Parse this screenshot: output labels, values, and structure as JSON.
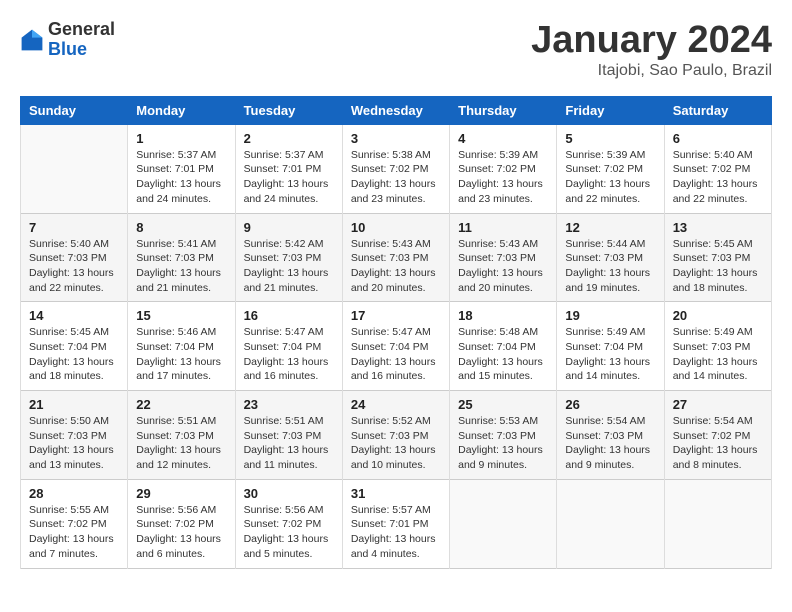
{
  "logo": {
    "general": "General",
    "blue": "Blue"
  },
  "title": "January 2024",
  "location": "Itajobi, Sao Paulo, Brazil",
  "days_header": [
    "Sunday",
    "Monday",
    "Tuesday",
    "Wednesday",
    "Thursday",
    "Friday",
    "Saturday"
  ],
  "weeks": [
    [
      {
        "day": "",
        "info": ""
      },
      {
        "day": "1",
        "info": "Sunrise: 5:37 AM\nSunset: 7:01 PM\nDaylight: 13 hours\nand 24 minutes."
      },
      {
        "day": "2",
        "info": "Sunrise: 5:37 AM\nSunset: 7:01 PM\nDaylight: 13 hours\nand 24 minutes."
      },
      {
        "day": "3",
        "info": "Sunrise: 5:38 AM\nSunset: 7:02 PM\nDaylight: 13 hours\nand 23 minutes."
      },
      {
        "day": "4",
        "info": "Sunrise: 5:39 AM\nSunset: 7:02 PM\nDaylight: 13 hours\nand 23 minutes."
      },
      {
        "day": "5",
        "info": "Sunrise: 5:39 AM\nSunset: 7:02 PM\nDaylight: 13 hours\nand 22 minutes."
      },
      {
        "day": "6",
        "info": "Sunrise: 5:40 AM\nSunset: 7:02 PM\nDaylight: 13 hours\nand 22 minutes."
      }
    ],
    [
      {
        "day": "7",
        "info": "Sunrise: 5:40 AM\nSunset: 7:03 PM\nDaylight: 13 hours\nand 22 minutes."
      },
      {
        "day": "8",
        "info": "Sunrise: 5:41 AM\nSunset: 7:03 PM\nDaylight: 13 hours\nand 21 minutes."
      },
      {
        "day": "9",
        "info": "Sunrise: 5:42 AM\nSunset: 7:03 PM\nDaylight: 13 hours\nand 21 minutes."
      },
      {
        "day": "10",
        "info": "Sunrise: 5:43 AM\nSunset: 7:03 PM\nDaylight: 13 hours\nand 20 minutes."
      },
      {
        "day": "11",
        "info": "Sunrise: 5:43 AM\nSunset: 7:03 PM\nDaylight: 13 hours\nand 20 minutes."
      },
      {
        "day": "12",
        "info": "Sunrise: 5:44 AM\nSunset: 7:03 PM\nDaylight: 13 hours\nand 19 minutes."
      },
      {
        "day": "13",
        "info": "Sunrise: 5:45 AM\nSunset: 7:03 PM\nDaylight: 13 hours\nand 18 minutes."
      }
    ],
    [
      {
        "day": "14",
        "info": "Sunrise: 5:45 AM\nSunset: 7:04 PM\nDaylight: 13 hours\nand 18 minutes."
      },
      {
        "day": "15",
        "info": "Sunrise: 5:46 AM\nSunset: 7:04 PM\nDaylight: 13 hours\nand 17 minutes."
      },
      {
        "day": "16",
        "info": "Sunrise: 5:47 AM\nSunset: 7:04 PM\nDaylight: 13 hours\nand 16 minutes."
      },
      {
        "day": "17",
        "info": "Sunrise: 5:47 AM\nSunset: 7:04 PM\nDaylight: 13 hours\nand 16 minutes."
      },
      {
        "day": "18",
        "info": "Sunrise: 5:48 AM\nSunset: 7:04 PM\nDaylight: 13 hours\nand 15 minutes."
      },
      {
        "day": "19",
        "info": "Sunrise: 5:49 AM\nSunset: 7:04 PM\nDaylight: 13 hours\nand 14 minutes."
      },
      {
        "day": "20",
        "info": "Sunrise: 5:49 AM\nSunset: 7:03 PM\nDaylight: 13 hours\nand 14 minutes."
      }
    ],
    [
      {
        "day": "21",
        "info": "Sunrise: 5:50 AM\nSunset: 7:03 PM\nDaylight: 13 hours\nand 13 minutes."
      },
      {
        "day": "22",
        "info": "Sunrise: 5:51 AM\nSunset: 7:03 PM\nDaylight: 13 hours\nand 12 minutes."
      },
      {
        "day": "23",
        "info": "Sunrise: 5:51 AM\nSunset: 7:03 PM\nDaylight: 13 hours\nand 11 minutes."
      },
      {
        "day": "24",
        "info": "Sunrise: 5:52 AM\nSunset: 7:03 PM\nDaylight: 13 hours\nand 10 minutes."
      },
      {
        "day": "25",
        "info": "Sunrise: 5:53 AM\nSunset: 7:03 PM\nDaylight: 13 hours\nand 9 minutes."
      },
      {
        "day": "26",
        "info": "Sunrise: 5:54 AM\nSunset: 7:03 PM\nDaylight: 13 hours\nand 9 minutes."
      },
      {
        "day": "27",
        "info": "Sunrise: 5:54 AM\nSunset: 7:02 PM\nDaylight: 13 hours\nand 8 minutes."
      }
    ],
    [
      {
        "day": "28",
        "info": "Sunrise: 5:55 AM\nSunset: 7:02 PM\nDaylight: 13 hours\nand 7 minutes."
      },
      {
        "day": "29",
        "info": "Sunrise: 5:56 AM\nSunset: 7:02 PM\nDaylight: 13 hours\nand 6 minutes."
      },
      {
        "day": "30",
        "info": "Sunrise: 5:56 AM\nSunset: 7:02 PM\nDaylight: 13 hours\nand 5 minutes."
      },
      {
        "day": "31",
        "info": "Sunrise: 5:57 AM\nSunset: 7:01 PM\nDaylight: 13 hours\nand 4 minutes."
      },
      {
        "day": "",
        "info": ""
      },
      {
        "day": "",
        "info": ""
      },
      {
        "day": "",
        "info": ""
      }
    ]
  ]
}
